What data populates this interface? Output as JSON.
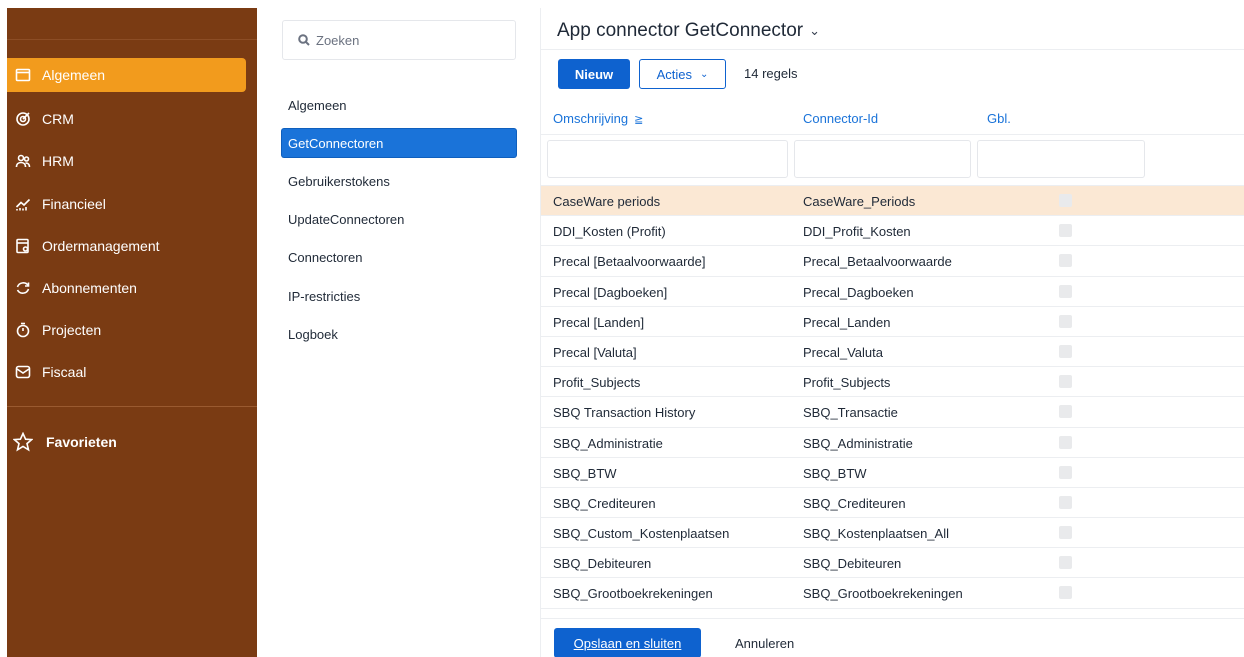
{
  "sidebar": {
    "items": [
      {
        "label": "Algemeen",
        "icon": "window-icon",
        "active": true
      },
      {
        "label": "CRM",
        "icon": "target-icon",
        "active": false
      },
      {
        "label": "HRM",
        "icon": "people-icon",
        "active": false
      },
      {
        "label": "Financieel",
        "icon": "chart-icon",
        "active": false
      },
      {
        "label": "Ordermanagement",
        "icon": "receipt-icon",
        "active": false
      },
      {
        "label": "Abonnementen",
        "icon": "refresh-icon",
        "active": false
      },
      {
        "label": "Projecten",
        "icon": "stopwatch-icon",
        "active": false
      },
      {
        "label": "Fiscaal",
        "icon": "inbox-icon",
        "active": false
      }
    ],
    "favorites_label": "Favorieten"
  },
  "middle": {
    "search_placeholder": "Zoeken",
    "items": [
      {
        "label": "Algemeen",
        "active": false
      },
      {
        "label": "GetConnectoren",
        "active": true
      },
      {
        "label": "Gebruikerstokens",
        "active": false
      },
      {
        "label": "UpdateConnectoren",
        "active": false
      },
      {
        "label": "Connectoren",
        "active": false
      },
      {
        "label": "IP-restricties",
        "active": false
      },
      {
        "label": "Logboek",
        "active": false
      }
    ]
  },
  "main": {
    "title": "App connector GetConnector",
    "new_label": "Nieuw",
    "acties_label": "Acties",
    "row_count": "14 regels",
    "columns": [
      "Omschrijving",
      "Connector-Id",
      "Gbl."
    ],
    "rows": [
      {
        "omschrijving": "CaseWare periods",
        "connector_id": "CaseWare_Periods",
        "highlight": true
      },
      {
        "omschrijving": "DDI_Kosten (Profit)",
        "connector_id": "DDI_Profit_Kosten"
      },
      {
        "omschrijving": "Precal [Betaalvoorwaarde]",
        "connector_id": "Precal_Betaalvoorwaarde"
      },
      {
        "omschrijving": "Precal [Dagboeken]",
        "connector_id": "Precal_Dagboeken"
      },
      {
        "omschrijving": "Precal [Landen]",
        "connector_id": "Precal_Landen"
      },
      {
        "omschrijving": "Precal [Valuta]",
        "connector_id": "Precal_Valuta"
      },
      {
        "omschrijving": "Profit_Subjects",
        "connector_id": "Profit_Subjects"
      },
      {
        "omschrijving": "SBQ Transaction History",
        "connector_id": "SBQ_Transactie"
      },
      {
        "omschrijving": "SBQ_Administratie",
        "connector_id": "SBQ_Administratie"
      },
      {
        "omschrijving": "SBQ_BTW",
        "connector_id": "SBQ_BTW"
      },
      {
        "omschrijving": "SBQ_Crediteuren",
        "connector_id": "SBQ_Crediteuren"
      },
      {
        "omschrijving": "SBQ_Custom_Kostenplaatsen",
        "connector_id": "SBQ_Kostenplaatsen_All"
      },
      {
        "omschrijving": "SBQ_Debiteuren",
        "connector_id": "SBQ_Debiteuren"
      },
      {
        "omschrijving": "SBQ_Grootboekrekeningen",
        "connector_id": "SBQ_Grootboekrekeningen"
      }
    ],
    "save_label": "Opslaan en sluiten",
    "cancel_label": "Annuleren"
  },
  "colors": {
    "sidebar_bg": "#7a3b13",
    "sidebar_active": "#f29b1d",
    "primary": "#0e62cf",
    "row_highlight": "#fbe8d4"
  }
}
